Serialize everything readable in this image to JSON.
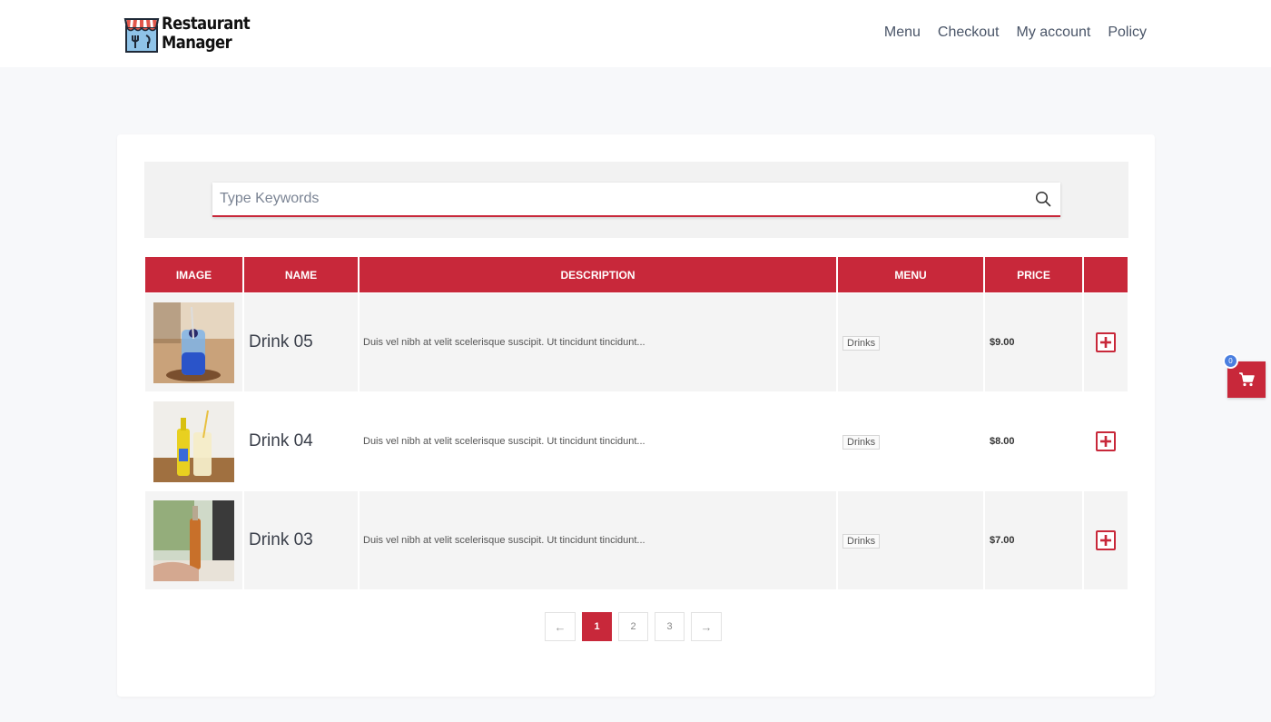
{
  "brand": {
    "line1": "Restaurant",
    "line2": "Manager"
  },
  "nav": {
    "items": [
      {
        "label": "Menu"
      },
      {
        "label": "Checkout"
      },
      {
        "label": "My account"
      },
      {
        "label": "Policy"
      }
    ]
  },
  "search": {
    "placeholder": "Type Keywords",
    "value": ""
  },
  "table": {
    "headers": [
      "IMAGE",
      "NAME",
      "DESCRIPTION",
      "MENU",
      "PRICE",
      ""
    ],
    "rows": [
      {
        "image": "drink-05-photo",
        "name": "Drink 05",
        "description": "Duis vel nibh at velit scelerisque suscipit. Ut tincidunt tincidunt...",
        "menu": "Drinks",
        "price": "$9.00"
      },
      {
        "image": "drink-04-photo",
        "name": "Drink 04",
        "description": "Duis vel nibh at velit scelerisque suscipit. Ut tincidunt tincidunt...",
        "menu": "Drinks",
        "price": "$8.00"
      },
      {
        "image": "drink-03-photo",
        "name": "Drink 03",
        "description": "Duis vel nibh at velit scelerisque suscipit. Ut tincidunt tincidunt...",
        "menu": "Drinks",
        "price": "$7.00"
      }
    ]
  },
  "pagination": {
    "prev": "←",
    "pages": [
      "1",
      "2",
      "3"
    ],
    "current": "1",
    "next": "→"
  },
  "cart": {
    "count": "0"
  },
  "colors": {
    "accent": "#c8283a",
    "badge": "#4a7fe0",
    "background": "#f7f8fa"
  },
  "icons": {
    "search": "search-icon",
    "cart": "cart-icon",
    "add": "plus-icon"
  }
}
